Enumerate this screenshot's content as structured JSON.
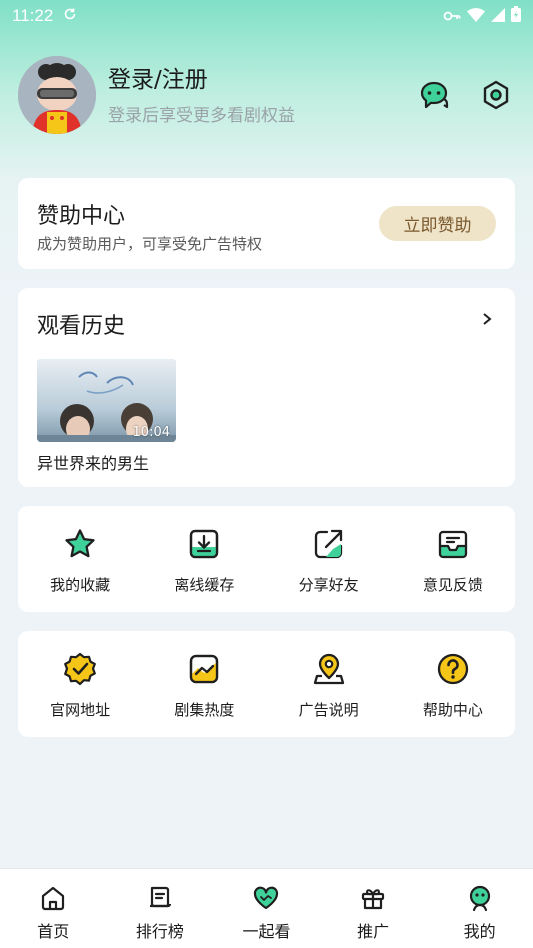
{
  "status_bar": {
    "time": "11:22"
  },
  "profile": {
    "title": "登录/注册",
    "subtitle": "登录后享受更多看剧权益",
    "actions": [
      {
        "icon": "chat-bubble-icon"
      },
      {
        "icon": "settings-icon"
      }
    ]
  },
  "sponsor": {
    "title": "赞助中心",
    "subtitle": "成为赞助用户，可享受免广告特权",
    "button_label": "立即赞助"
  },
  "history": {
    "title": "观看历史",
    "items": [
      {
        "name": "异世界来的男生",
        "duration": "10:04"
      }
    ]
  },
  "tools_row_1": [
    {
      "label": "我的收藏",
      "icon": "star-icon"
    },
    {
      "label": "离线缓存",
      "icon": "download-icon"
    },
    {
      "label": "分享好友",
      "icon": "share-icon"
    },
    {
      "label": "意见反馈",
      "icon": "feedback-inbox-icon"
    }
  ],
  "tools_row_2": [
    {
      "label": "官网地址",
      "icon": "verified-badge-icon"
    },
    {
      "label": "剧集热度",
      "icon": "trend-chart-icon"
    },
    {
      "label": "广告说明",
      "icon": "location-pin-icon"
    },
    {
      "label": "帮助中心",
      "icon": "help-question-icon"
    }
  ],
  "bottom_nav": [
    {
      "label": "首页",
      "icon": "home-icon"
    },
    {
      "label": "排行榜",
      "icon": "ranking-icon"
    },
    {
      "label": "一起看",
      "icon": "heart-icon"
    },
    {
      "label": "推广",
      "icon": "gift-icon"
    },
    {
      "label": "我的",
      "icon": "profile-face-icon"
    }
  ],
  "colors": {
    "accent_green": "#3fd19a",
    "accent_yellow": "#f5c518",
    "sponsor_button_bg": "#efe3c8",
    "sponsor_button_text": "#7a5a2e"
  }
}
